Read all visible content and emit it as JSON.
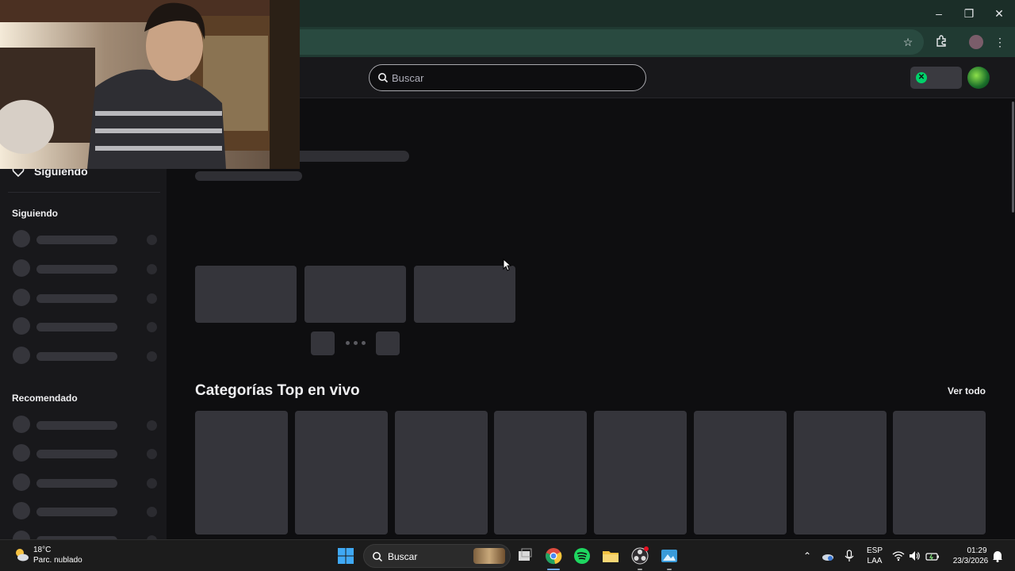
{
  "window": {
    "minimize": "–",
    "restore": "❐",
    "close": "✕"
  },
  "site": {
    "search_placeholder": "Buscar"
  },
  "sidebar": {
    "following_header": "Siguiendo",
    "following_section": "Siguiendo",
    "recommended_section": "Recomendado"
  },
  "main": {
    "top_categories_title": "Categorías Top en vivo",
    "see_all": "Ver todo"
  },
  "taskbar": {
    "weather_temp": "18°C",
    "weather_desc": "Parc. nublado",
    "search_label": "Buscar",
    "lang_top": "ESP",
    "lang_bottom": "LAA",
    "time": "01:29",
    "date": "23/3/2026"
  },
  "colors": {
    "background": "#0e0e10",
    "sidebar": "#18181b",
    "skeleton": "#35353b",
    "chrome_titlebar": "#1b2e28",
    "chrome_toolbar": "#203a32"
  }
}
